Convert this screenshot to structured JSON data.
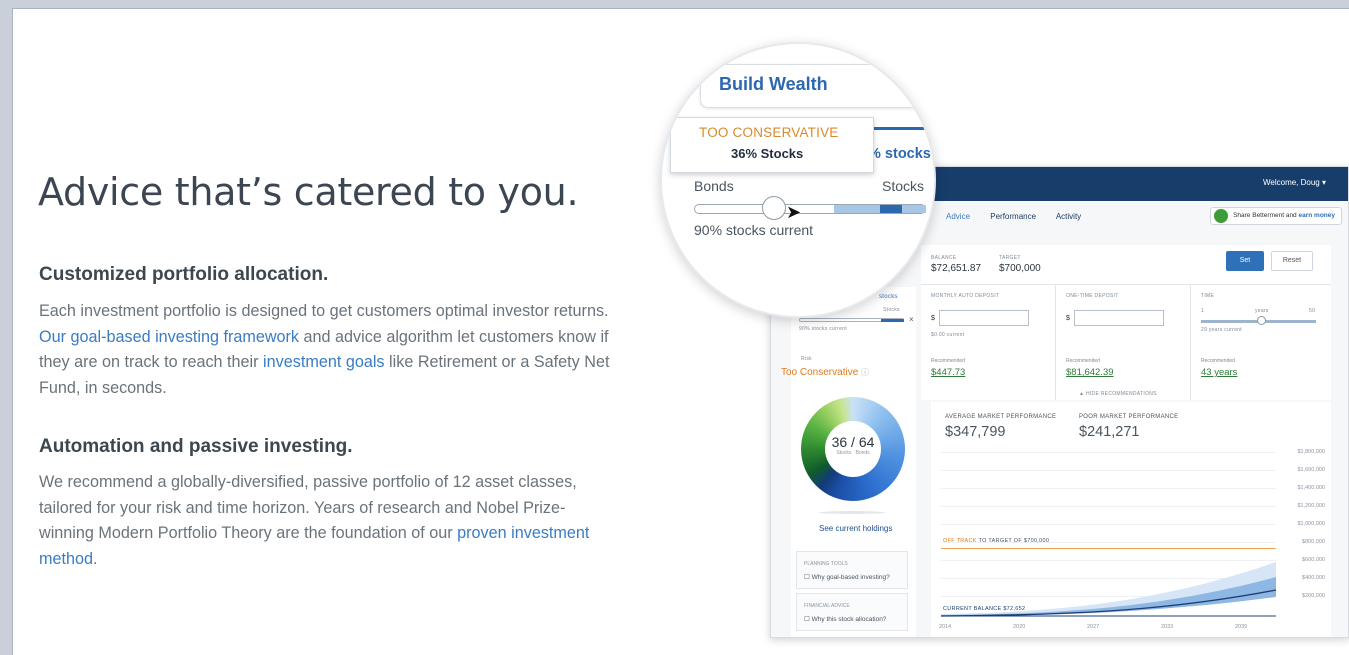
{
  "hero": {
    "headline": "Advice that’s catered to you."
  },
  "sections": [
    {
      "title": "Customized portfolio allocation.",
      "body_1": "Each investment portfolio is designed to get customers optimal investor returns.",
      "link_1": "Our goal-based investing framework",
      "body_2": "and advice algorithm let customers know if they are on track to reach their",
      "link_2": "investment goals",
      "body_3": "like Retirement or a Safety Net Fund, in seconds."
    },
    {
      "title": "Automation and passive investing.",
      "body_1": "We recommend a globally-diversified, passive portfolio of 12 asset classes, tailored for your risk and time horizon. Years of research and Nobel Prize-winning Modern Portfolio Theory are the foundation of our",
      "link_1": "proven investment method",
      "body_2": "."
    }
  ],
  "magnifier": {
    "goal_title": "Build Wealth",
    "tooltip_status": "TOO CONSERVATIVE",
    "tooltip_value": "36% Stocks",
    "tab_partial": "% stocks",
    "bonds_label": "Bonds",
    "stocks_label": "Stocks",
    "current_label": "90% stocks current"
  },
  "dashboard": {
    "welcome": "Welcome, Doug ▾",
    "nav": [
      "Advice",
      "Performance",
      "Activity"
    ],
    "share_text": "Share Betterment and",
    "share_bold": "earn money",
    "balance_label": "BALANCE",
    "balance_value": "$72,651.87",
    "target_label": "TARGET",
    "target_value": "$700,000",
    "set_label": "Set",
    "reset_label": "Reset",
    "monthly_label": "MONTHLY AUTO DEPOSIT",
    "monthly_current": "$0.00 current",
    "monthly_rec": "$447.73",
    "onetime_label": "ONE-TIME DEPOSIT",
    "onetime_rec": "$81,642.39",
    "time_label": "TIME",
    "time_min": "1",
    "time_unit": "years",
    "time_max": "50",
    "time_current": "29 years current",
    "time_rec": "43 years",
    "recommended_label": "Recommended",
    "hide_rec": "▲ HIDE RECOMMENDATIONS",
    "left_stocks_tab": "stocks",
    "left_current": "90% stocks current",
    "left_stocks_label": "Stocks",
    "risk_label": "Risk",
    "risk_value": "Too Conservative",
    "donut_main": "36 / 64",
    "donut_sub_stocks": "Stocks",
    "donut_sub_bonds": "Bonds",
    "see_holdings": "See current holdings",
    "tool1_title": "PLANNING TOOLS",
    "tool1_item": "Why goal-based investing?",
    "tool2_title": "FINANCIAL ADVICE",
    "tool2_item": "Why this stock allocation?",
    "avg_label": "AVERAGE MARKET PERFORMANCE",
    "avg_value": "$347,799",
    "poor_label": "POOR MARKET PERFORMANCE",
    "poor_value": "$241,271",
    "y_labels": [
      "$1,800,000",
      "$1,600,000",
      "$1,400,000",
      "$1,200,000",
      "$1,000,000",
      "$800,000",
      "$600,000",
      "$400,000",
      "$200,000"
    ],
    "x_labels": [
      "2014",
      "2020",
      "2027",
      "2033",
      "2039"
    ],
    "off_track": "OFF TRACK",
    "off_track_rest": "TO TARGET OF $700,000",
    "current_balance": "CURRENT BALANCE $72,652"
  },
  "colors": {
    "link": "#3a7cc4",
    "nav_bar": "#173d6b",
    "warning": "#e27a1a",
    "recommended": "#2f7b38"
  }
}
